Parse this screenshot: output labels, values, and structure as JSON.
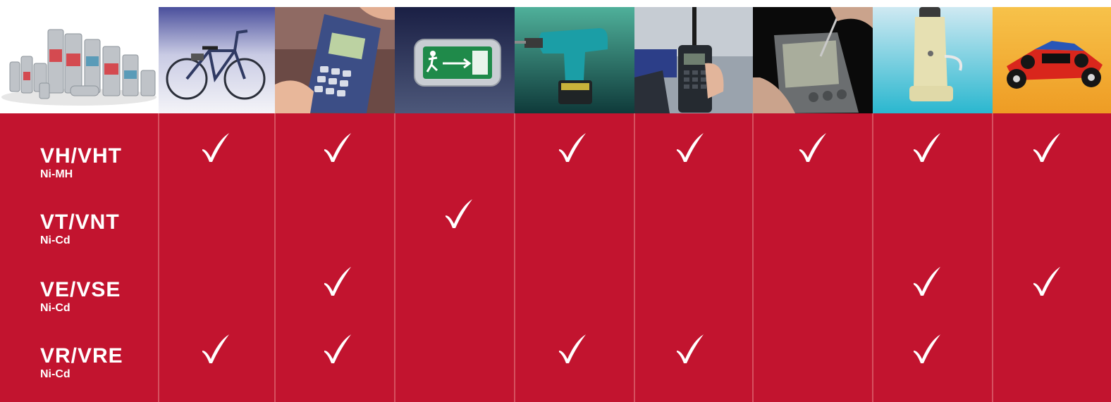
{
  "rows": [
    {
      "name": "VH/VHT",
      "chem": "Ni-MH",
      "checks": [
        true,
        true,
        false,
        true,
        true,
        true,
        true,
        true
      ]
    },
    {
      "name": "VT/VNT",
      "chem": "Ni-Cd",
      "checks": [
        false,
        false,
        true,
        false,
        false,
        false,
        false,
        false
      ]
    },
    {
      "name": "VE/VSE",
      "chem": "Ni-Cd",
      "checks": [
        false,
        true,
        false,
        false,
        false,
        false,
        true,
        true
      ]
    },
    {
      "name": "VR/VRE",
      "chem": "Ni-Cd",
      "checks": [
        true,
        true,
        false,
        true,
        true,
        false,
        true,
        false
      ]
    }
  ],
  "applications": [
    {
      "icon": "bicycle-icon"
    },
    {
      "icon": "payment-terminal-icon"
    },
    {
      "icon": "emergency-exit-sign-icon"
    },
    {
      "icon": "cordless-drill-icon"
    },
    {
      "icon": "two-way-radio-icon"
    },
    {
      "icon": "pda-icon"
    },
    {
      "icon": "electric-shaver-icon"
    },
    {
      "icon": "rc-car-icon"
    }
  ],
  "colors": {
    "table_background": "#c2142f",
    "divider": "#d6505f",
    "text": "#ffffff"
  }
}
